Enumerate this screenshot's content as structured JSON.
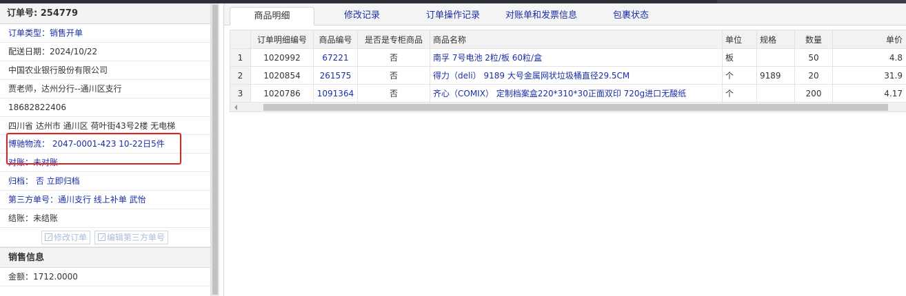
{
  "order": {
    "title": "订单号: 254779",
    "type": "订单类型：销售开单",
    "date": "配送日期：2024/10/22",
    "company": "中国农业银行股份有限公司",
    "contact": "贾老师，达州分行--通川区支行",
    "phone": "18682822406",
    "address": "四川省 达州市 通川区 荷叶街43号2楼 无电梯",
    "logistics": "博驰物流：  2047-0001-423 10-22日5件",
    "reconcile": "对账：未对账",
    "archive_label": "归档：",
    "archive_value": "否 立即归档",
    "third_party": "第三方单号：通川支行 线上补单 武怡",
    "settle": "结账：未结账",
    "edit_order_label": "修改订单",
    "edit_third_label": "编辑第三方单号"
  },
  "sales": {
    "title": "销售信息",
    "amount": "金额：1712.0000"
  },
  "tabs": [
    {
      "label": "商品明细"
    },
    {
      "label": "修改记录"
    },
    {
      "label": "订单操作记录"
    },
    {
      "label": "对账单和发票信息"
    },
    {
      "label": "包裹状态"
    }
  ],
  "table": {
    "headers": [
      "订单明细编号",
      "商品编号",
      "是否是专柜商品",
      "商品名称",
      "单位",
      "规格",
      "数量",
      "单价"
    ],
    "rows": [
      {
        "idx": "1",
        "detail_no": "1020992",
        "sku": "67221",
        "counter": "否",
        "name": "南孚 7号电池 2粒/板 60粒/盒",
        "unit": "板",
        "spec": "",
        "qty": "50",
        "price": "4.8"
      },
      {
        "idx": "2",
        "detail_no": "1020854",
        "sku": "261575",
        "counter": "否",
        "name": "得力（deli） 9189 大号金属网状垃圾桶直径29.5CM",
        "unit": "个",
        "spec": "9189",
        "qty": "20",
        "price": "31.9"
      },
      {
        "idx": "3",
        "detail_no": "1020786",
        "sku": "1091364",
        "counter": "否",
        "name": "齐心（COMIX） 定制档案盒220*310*30正面双印 720g进口无酸纸",
        "unit": "个",
        "spec": "",
        "qty": "200",
        "price": "4.17"
      }
    ]
  },
  "colors": {
    "link": "#1a2ea8",
    "highlight": "#e0201c"
  }
}
